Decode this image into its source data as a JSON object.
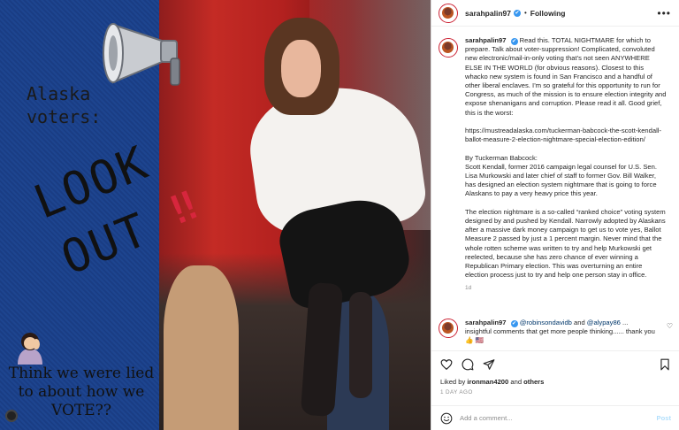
{
  "image": {
    "alt": "",
    "text_alaska": "Alaska voters:",
    "text_look": "LOOK",
    "text_out": "OUT",
    "text_bang": "‼",
    "text_lied": "Think we were lied to about how we VOTE??",
    "colors": {
      "blue_panel": "#1d4590",
      "red_backdrop": "#c42b25",
      "exclaim": "#d7263d"
    }
  },
  "header": {
    "username": "sarahpalin97",
    "verified": "✔",
    "dot": "•",
    "follow_status": "Following",
    "more": "•••"
  },
  "caption": {
    "username": "sarahpalin97",
    "verified": "✔",
    "text": " Read this. TOTAL NIGHTMARE for which to prepare. Talk about voter-suppression! Complicated, convoluted new electronic/mail-in-only voting that’s not seen ANYWHERE ELSE IN THE WORLD (for obvious reasons). Closest to this whacko new system is found in San Francisco and a handful of other liberal enclaves. I’m so grateful for this opportunity to run for Congress, as much of the mission is to ensure election integrity and expose shenanigans and corruption. Please read it all. Good grief, this is the worst:\n\nhttps://mustreadalaska.com/tuckerman-babcock-the-scott-kendall-ballot-measure-2-election-nightmare-special-election-edition/\n\nBy Tuckerman Babcock:\nScott Kendall, former 2016 campaign legal counsel for U.S. Sen. Lisa Murkowski and later chief of staff to former Gov. Bill Walker, has designed an election system nightmare that is going to force Alaskans to pay a very heavy price this year.\n\nThe election nightmare is a so-called “ranked choice” voting system designed by and pushed by Kendall. Narrowly adopted by Alaskans after a massive dark money campaign to get us to vote yes, Ballot Measure 2 passed by just a 1 percent margin. Never mind that the whole rotten scheme was written to try and help Murkowski get reelected, because she has zero chance of ever winning a Republican Primary election. This was overturning an entire election process just to try and help one person stay in office.",
    "time": "1d"
  },
  "comment": {
    "username": "sarahpalin97",
    "verified": "✔",
    "mention1": "@robinsondavidb",
    "and": " and ",
    "mention2": "@alypay86",
    "dots": " ...",
    "text": "insightful comments that get more people thinking...... thank you 👍 🇺🇸",
    "like_icon": "♡"
  },
  "actions": {
    "liked_by_prefix": "Liked by ",
    "liked_by_user": "ironman4200",
    "liked_by_and": " and ",
    "liked_by_others": "others",
    "time_ago": "1 DAY AGO"
  },
  "add_comment": {
    "placeholder": "Add a comment...",
    "post_label": "Post"
  }
}
